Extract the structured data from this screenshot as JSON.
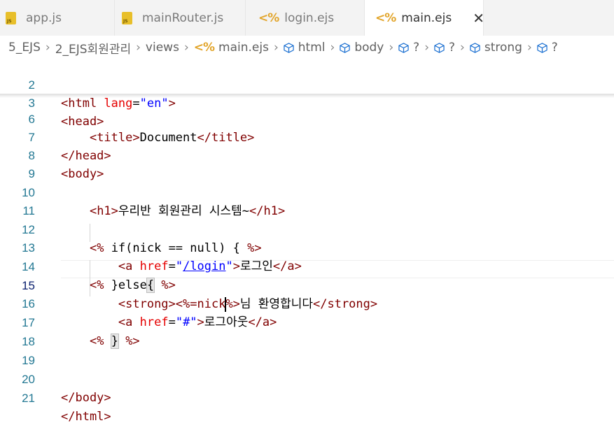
{
  "tabs": [
    {
      "label": "app.js",
      "icon": "js-file-icon"
    },
    {
      "label": "mainRouter.js",
      "icon": "js-file-icon"
    },
    {
      "label": "login.ejs",
      "icon": "ejs-file-icon"
    },
    {
      "label": "main.ejs",
      "icon": "ejs-file-icon",
      "active": true
    }
  ],
  "tab_close": "✕",
  "breadcrumb": {
    "items": [
      "5_EJS",
      "2_EJS회원관리",
      "views",
      "main.ejs",
      "html",
      "body",
      "?",
      "?",
      "strong",
      "?"
    ],
    "separator": "›"
  },
  "lines": {
    "l2": {
      "num": "2"
    },
    "l3": {
      "num": "3"
    },
    "l6": {
      "num": "6"
    },
    "l7": {
      "num": "7"
    },
    "l8": {
      "num": "8"
    },
    "l9": {
      "num": "9"
    },
    "l10": {
      "num": "10",
      "text": "우리반 회원관리 시스템~"
    },
    "l11": {
      "num": "11"
    },
    "l12": {
      "num": "12"
    },
    "l13": {
      "num": "13",
      "text": "로그인"
    },
    "l14": {
      "num": "14"
    },
    "l15": {
      "num": "15",
      "text": "님 환영합니다"
    },
    "l16": {
      "num": "16",
      "text": "로그아웃"
    },
    "l17": {
      "num": "17"
    },
    "l18": {
      "num": "18"
    },
    "l19": {
      "num": "19"
    },
    "l20": {
      "num": "20"
    },
    "l21": {
      "num": "21"
    }
  },
  "tokens": {
    "title_text": "Document",
    "lang_val": "\"en\"",
    "href_login": "/login",
    "href_hash": "\"#\"",
    "nick_expr": "%=nick",
    "if_expr": "if(nick == null) { ",
    "else_expr": "}else",
    "close_brace": "}"
  },
  "colors": {
    "tag": "#800000",
    "attr": "#e50000",
    "value": "#0000ff",
    "line_number": "#237893",
    "ejs_icon": "#e2a52b",
    "js_icon": "#e8bf2a"
  }
}
